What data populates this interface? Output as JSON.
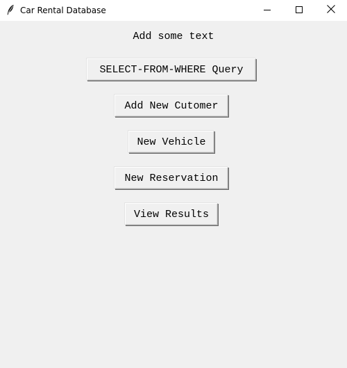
{
  "window": {
    "title": "Car Rental Database",
    "icon": "feather-icon",
    "controls": {
      "minimize": "minimize-icon",
      "maximize": "maximize-icon",
      "close": "close-icon"
    }
  },
  "main": {
    "heading": "Add some text",
    "buttons": [
      {
        "label": "SELECT-FROM-WHERE Query"
      },
      {
        "label": "Add New Cutomer"
      },
      {
        "label": "New Vehicle"
      },
      {
        "label": "New Reservation"
      },
      {
        "label": "View Results"
      }
    ]
  }
}
